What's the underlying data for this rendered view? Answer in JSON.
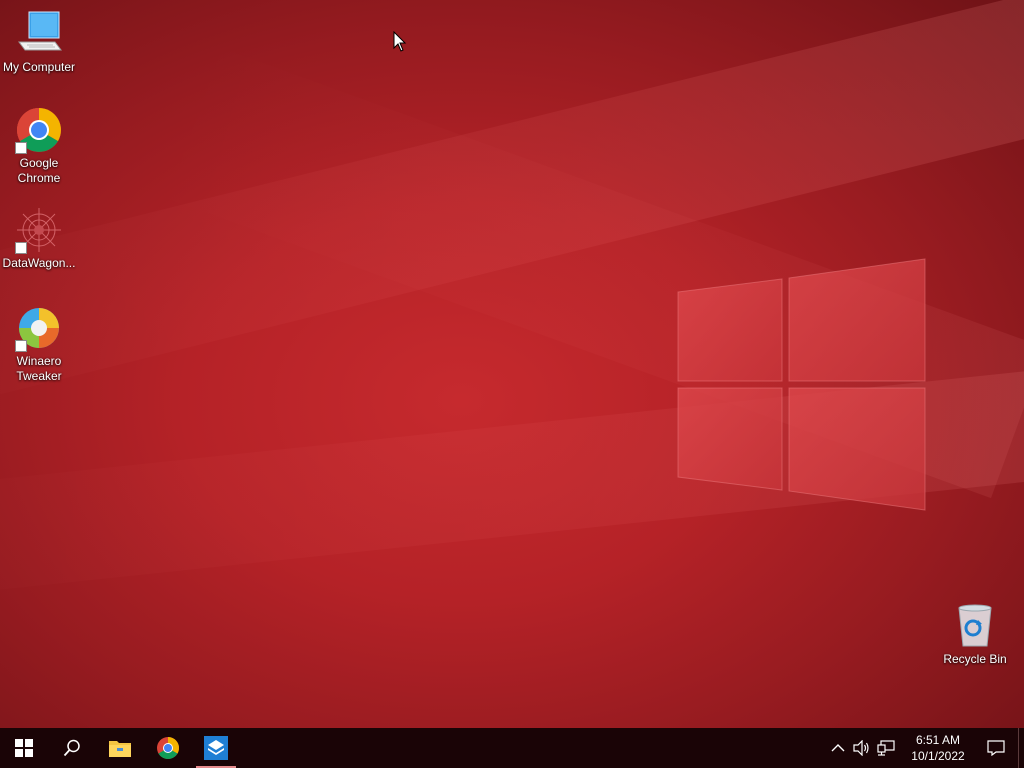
{
  "desktop": {
    "icons": [
      {
        "label": "My Computer"
      },
      {
        "label": "Google Chrome"
      },
      {
        "label": "DataWagon..."
      },
      {
        "label": "Winaero Tweaker"
      },
      {
        "label": "Recycle Bin"
      }
    ]
  },
  "taskbar": {
    "clock_time": "6:51 AM",
    "clock_date": "10/1/2022",
    "pinned": [
      {
        "icon": "start-windows-icon"
      },
      {
        "icon": "search-icon"
      },
      {
        "icon": "file-explorer-icon"
      },
      {
        "icon": "chrome-icon"
      },
      {
        "icon": "winaero-tweaker-icon"
      }
    ],
    "tray": [
      {
        "icon": "chevron-up-icon"
      },
      {
        "icon": "speaker-icon"
      },
      {
        "icon": "network-icon"
      },
      {
        "icon": "notification-icon"
      }
    ]
  },
  "colors": {
    "wallpaper": "#b52227",
    "taskbar": "#1a0406",
    "accent": "#e58a8c"
  }
}
